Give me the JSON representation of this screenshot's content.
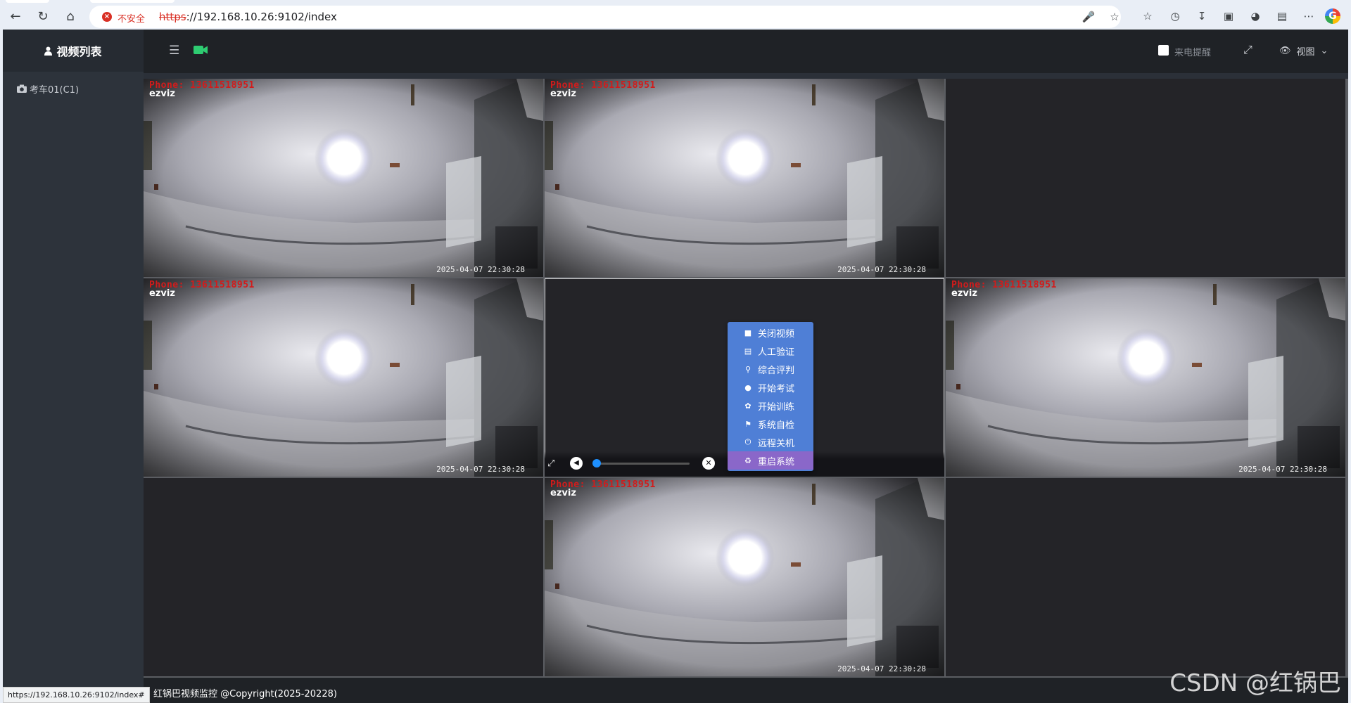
{
  "browser": {
    "insecure_label": "不安全",
    "url_scheme": "https",
    "url_rest": "://192.168.10.26:9102/index",
    "status_url": "https://192.168.10.26:9102/index#"
  },
  "sidebar": {
    "title": "视频列表",
    "items": [
      {
        "label": "考车01(C1)"
      }
    ]
  },
  "topbar": {
    "call_alert_label": "来电提醒",
    "view_label": "视图"
  },
  "overlay": {
    "phone_text": "Phone: 13611518951",
    "brand_text": "ezviz",
    "timestamp": "2025-04-07 22:30:28"
  },
  "grid": {
    "cells": [
      {
        "video": true
      },
      {
        "video": true
      },
      {
        "video": false
      },
      {
        "video": true
      },
      {
        "video": false,
        "selected": true
      },
      {
        "video": true
      },
      {
        "video": false
      },
      {
        "video": true
      },
      {
        "video": false
      }
    ]
  },
  "context_menu": {
    "items": [
      {
        "label": "关闭视频",
        "icon": "video-camera-icon"
      },
      {
        "label": "人工验证",
        "icon": "id-card-icon"
      },
      {
        "label": "综合评判",
        "icon": "key-icon"
      },
      {
        "label": "开始考试",
        "icon": "users-icon"
      },
      {
        "label": "开始训练",
        "icon": "leaf-icon"
      },
      {
        "label": "系统自检",
        "icon": "flag-icon"
      },
      {
        "label": "远程关机",
        "icon": "power-icon"
      },
      {
        "label": "重启系统",
        "icon": "recycle-icon"
      }
    ],
    "highlighted_index": 7
  },
  "footer": {
    "text": "红锅巴视频监控 @Copyright(2025-20228)"
  },
  "watermark": "CSDN @红锅巴",
  "colors": {
    "accent_green": "#2ecc71",
    "menu_blue": "#4f7fd6",
    "menu_hover": "#8a67c9",
    "overlay_red": "#d21b1b"
  }
}
